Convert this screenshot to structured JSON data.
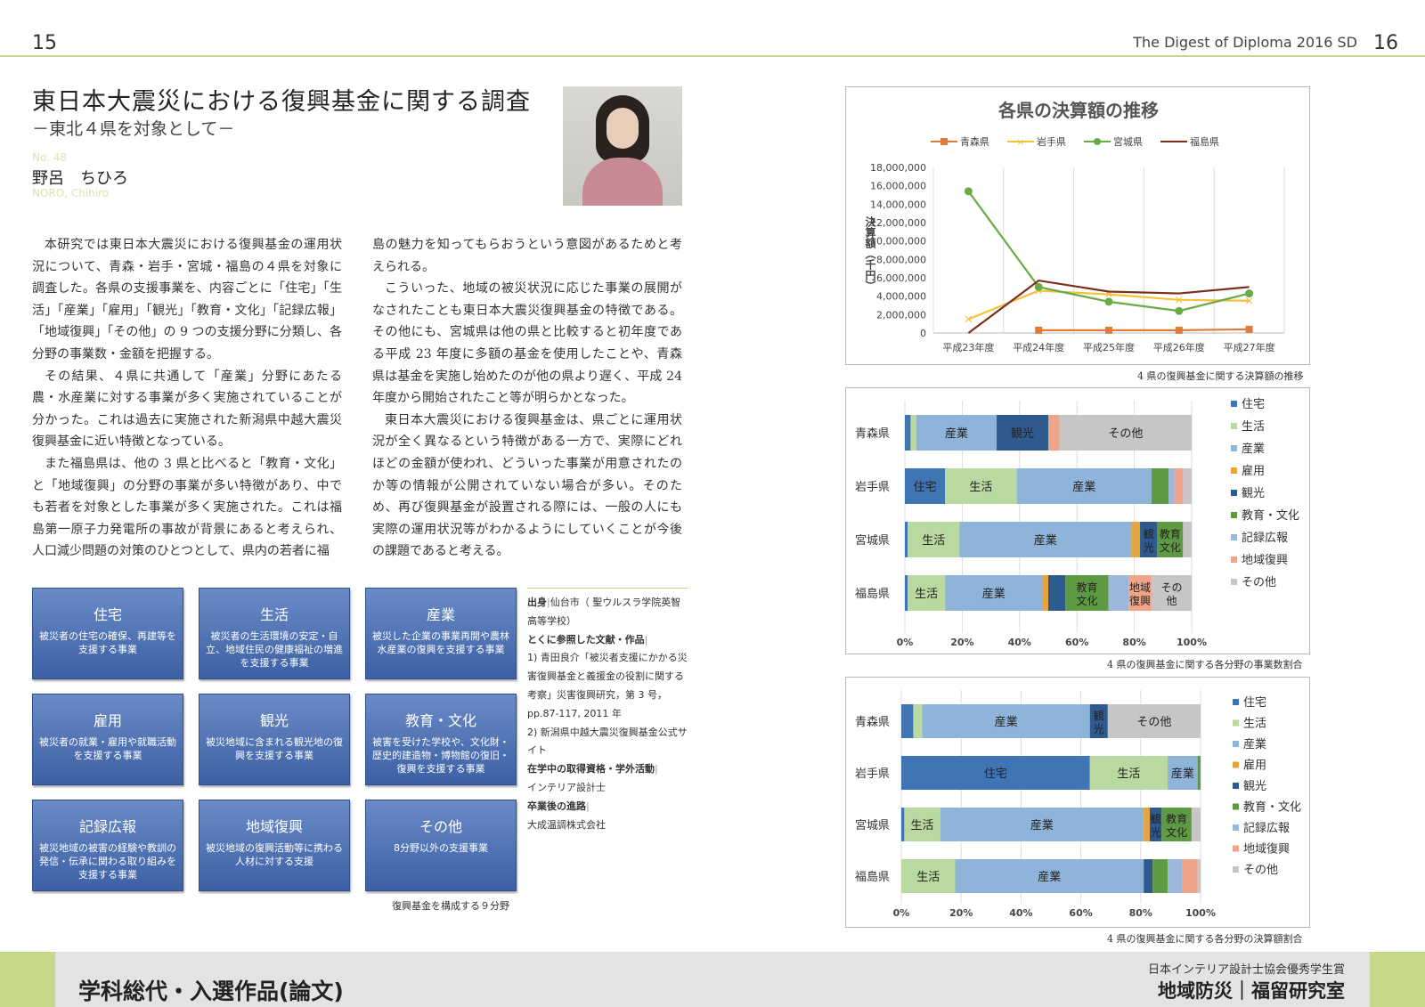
{
  "header": {
    "page_left": "15",
    "page_right": "16",
    "digest": "The Digest of Diploma 2016   SD"
  },
  "article": {
    "title": "東日本大震災における復興基金に関する調査",
    "subtitle": "－東北４県を対象として－",
    "student_no": "No. 48",
    "author": "野呂　ちひろ",
    "author_roman": "NORO, Chihiro"
  },
  "body": {
    "col1": [
      "本研究では東日本大震災における復興基金の運用状況について、青森・岩手・宮城・福島の４県を対象に調査した。各県の支援事業を、内容ごとに「住宅」「生活」「産業」「雇用」「観光」「教育・文化」「記録広報」「地域復興」「その他」の 9 つの支援分野に分類し、各分野の事業数・金額を把握する。",
      "その結果、４県に共通して「産業」分野にあたる農・水産業に対する事業が多く実施されていることが分かった。これは過去に実施された新潟県中越大震災復興基金に近い特徴となっている。",
      "また福島県は、他の 3 県と比べると「教育・文化」と「地域復興」の分野の事業が多い特徴があり、中でも若者を対象とした事業が多く実施された。これは福島第一原子力発電所の事故が背景にあると考えられ、人口減少問題の対策のひとつとして、県内の若者に福"
    ],
    "col2": [
      "島の魅力を知ってもらおうという意図があるためと考えられる。",
      "こういった、地域の被災状況に応じた事業の展開がなされたことも東日本大震災復興基金の特徴である。その他にも、宮城県は他の県と比較すると初年度である平成 23 年度に多額の基金を使用したことや、青森県は基金を実施し始めたのが他の県より遅く、平成 24 年度から開始されたこと等が明らかとなった。",
      "東日本大震災における復興基金は、県ごとに運用状況が全く異なるという特徴がある一方で、実際にどれほどの金額が使われ、どういった事業が用意されたのか等の情報が公開されていない場合が多い。そのため、再び復興基金が設置される際には、一般の人にも実際の運用状況等がわかるようにしていくことが今後の課題であると考える。"
    ]
  },
  "fields": {
    "caption": "復興基金を構成する９分野",
    "items": [
      {
        "name": "住宅",
        "desc": "被災者の住宅の確保、再建等を支援する事業"
      },
      {
        "name": "生活",
        "desc": "被災者の生活環境の安定・自立、地域住民の健康福祉の増進を支援する事業"
      },
      {
        "name": "産業",
        "desc": "被災した企業の事業再開や農林水産業の復興を支援する事業"
      },
      {
        "name": "雇用",
        "desc": "被災者の就業・雇用や就職活動を支援する事業"
      },
      {
        "name": "観光",
        "desc": "被災地域に含まれる観光地の復興を支援する事業"
      },
      {
        "name": "教育・文化",
        "desc": "被害を受けた学校や、文化財・歴史的建造物・博物館の復旧・復興を支援する事業"
      },
      {
        "name": "記録広報",
        "desc": "被災地域の被害の経験や教訓の発信・伝承に関わる取り組みを支援する事業"
      },
      {
        "name": "地域復興",
        "desc": "被災地域の復興活動等に携わる人材に対する支援"
      },
      {
        "name": "その他",
        "desc": "8分野以外の支援事業"
      }
    ]
  },
  "profile": {
    "origin_label": "出身",
    "origin_value": "仙台市（ 聖ウルスラ学院英智高等学校）",
    "refs_label": "とくに参照した文献・作品",
    "ref1": "1) 青田良介「被災者支援にかかる災害復興基金と義援金の役割に関する考察」災害復興研究，第 3 号，pp.87-117, 2011 年",
    "ref2": "2) 新潟県中越大震災復興基金公式サイト",
    "qual_label": "在学中の取得資格・学外活動",
    "qual_value": "インテリア設計士",
    "career_label": "卒業後の進路",
    "career_value": "大成温調株式会社",
    "sep": "|"
  },
  "captions": {
    "line": "4 県の復興基金に関する決算額の推移",
    "bar1": "4 県の復興基金に関する各分野の事業数割合",
    "bar2": "4 県の復興基金に関する各分野の決算額割合"
  },
  "footer": {
    "left": "学科総代・入選作品(論文)",
    "right_small": "日本インテリア設計士協会優秀学生賞",
    "right_big": "地域防災｜福留研究室"
  },
  "colors": {
    "aomori": "#e07b39",
    "iwate": "#f2c23a",
    "miyagi": "#6aaa45",
    "fukushima": "#7a2f1d",
    "cat": [
      "#3f74b5",
      "#b9d9a0",
      "#8fb4d9",
      "#e8a33a",
      "#2e5a8f",
      "#5e9a43",
      "#9bb8dc",
      "#f0a48a",
      "#c6c6c6"
    ],
    "field_bg": "#4a6fb3",
    "accent_green": "#c5d88a"
  },
  "chart_data": [
    {
      "type": "line",
      "title": "各県の決算額の推移",
      "ylabel": "決算額（千円）",
      "categories": [
        "平成23年度",
        "平成24年度",
        "平成25年度",
        "平成26年度",
        "平成27年度"
      ],
      "ylim": [
        0,
        18000000
      ],
      "yticks": [
        "0",
        "2,000,000",
        "4,000,000",
        "6,000,000",
        "8,000,000",
        "10,000,000",
        "12,000,000",
        "14,000,000",
        "16,000,000",
        "18,000,000"
      ],
      "legend_position": "top",
      "series": [
        {
          "name": "青森県",
          "marker": "square",
          "values": [
            null,
            300000,
            300000,
            300000,
            400000
          ]
        },
        {
          "name": "岩手県",
          "marker": "x",
          "values": [
            1500000,
            4600000,
            4200000,
            3600000,
            3500000
          ]
        },
        {
          "name": "宮城県",
          "marker": "circle",
          "values": [
            15400000,
            5000000,
            3400000,
            2400000,
            4300000
          ]
        },
        {
          "name": "福島県",
          "marker": "none",
          "values": [
            0,
            5700000,
            4500000,
            4300000,
            5000000
          ]
        }
      ]
    },
    {
      "type": "bar",
      "orientation": "horizontal-stacked-100",
      "categories": [
        "青森県",
        "岩手県",
        "宮城県",
        "福島県"
      ],
      "xticks": [
        "0%",
        "20%",
        "40%",
        "60%",
        "80%",
        "100%"
      ],
      "legend_position": "right",
      "series": [
        {
          "name": "住宅",
          "values": [
            2,
            14,
            1,
            1
          ]
        },
        {
          "name": "生活",
          "values": [
            2,
            25,
            18,
            13
          ]
        },
        {
          "name": "産業",
          "values": [
            28,
            47,
            60,
            34
          ]
        },
        {
          "name": "雇用",
          "values": [
            0,
            0,
            3,
            2
          ]
        },
        {
          "name": "観光",
          "values": [
            18,
            0,
            6,
            6
          ]
        },
        {
          "name": "教育・文化",
          "values": [
            0,
            6,
            9,
            15
          ]
        },
        {
          "name": "記録広報",
          "values": [
            0,
            2,
            0,
            7
          ]
        },
        {
          "name": "地域復興",
          "values": [
            4,
            3,
            0,
            8
          ]
        },
        {
          "name": "その他",
          "values": [
            46,
            3,
            3,
            14
          ]
        }
      ],
      "bar_labels": [
        [
          null,
          null,
          "産業",
          null,
          "観光",
          null,
          null,
          null,
          "その他"
        ],
        [
          "住宅",
          "生活",
          "産業",
          null,
          null,
          null,
          null,
          null,
          null
        ],
        [
          null,
          "生活",
          "産業",
          null,
          "観光",
          "教育文化",
          null,
          null,
          null
        ],
        [
          null,
          "生活",
          "産業",
          null,
          null,
          "教育文化",
          null,
          "地域復興",
          "その他"
        ]
      ]
    },
    {
      "type": "bar",
      "orientation": "horizontal-stacked-100",
      "categories": [
        "青森県",
        "岩手県",
        "宮城県",
        "福島県"
      ],
      "xticks": [
        "0%",
        "20%",
        "40%",
        "60%",
        "80%",
        "100%"
      ],
      "legend_position": "right",
      "series": [
        {
          "name": "住宅",
          "values": [
            4,
            63,
            1,
            0
          ]
        },
        {
          "name": "生活",
          "values": [
            3,
            26,
            12,
            18
          ]
        },
        {
          "name": "産業",
          "values": [
            56,
            10,
            68,
            63
          ]
        },
        {
          "name": "雇用",
          "values": [
            0,
            0,
            2,
            0
          ]
        },
        {
          "name": "観光",
          "values": [
            6,
            0,
            4,
            3
          ]
        },
        {
          "name": "教育・文化",
          "values": [
            0,
            1,
            10,
            5
          ]
        },
        {
          "name": "記録広報",
          "values": [
            0,
            0,
            0,
            5
          ]
        },
        {
          "name": "地域復興",
          "values": [
            0,
            0,
            0,
            5
          ]
        },
        {
          "name": "その他",
          "values": [
            31,
            0,
            3,
            1
          ]
        }
      ],
      "bar_labels": [
        [
          null,
          null,
          "産業",
          null,
          "観光",
          null,
          null,
          null,
          "その他"
        ],
        [
          "住宅",
          "生活",
          "産業",
          null,
          null,
          null,
          null,
          null,
          null
        ],
        [
          null,
          "生活",
          "産業",
          null,
          "観光",
          "教育文化",
          null,
          null,
          null
        ],
        [
          null,
          "生活",
          "産業",
          null,
          null,
          null,
          null,
          null,
          null
        ]
      ]
    }
  ]
}
